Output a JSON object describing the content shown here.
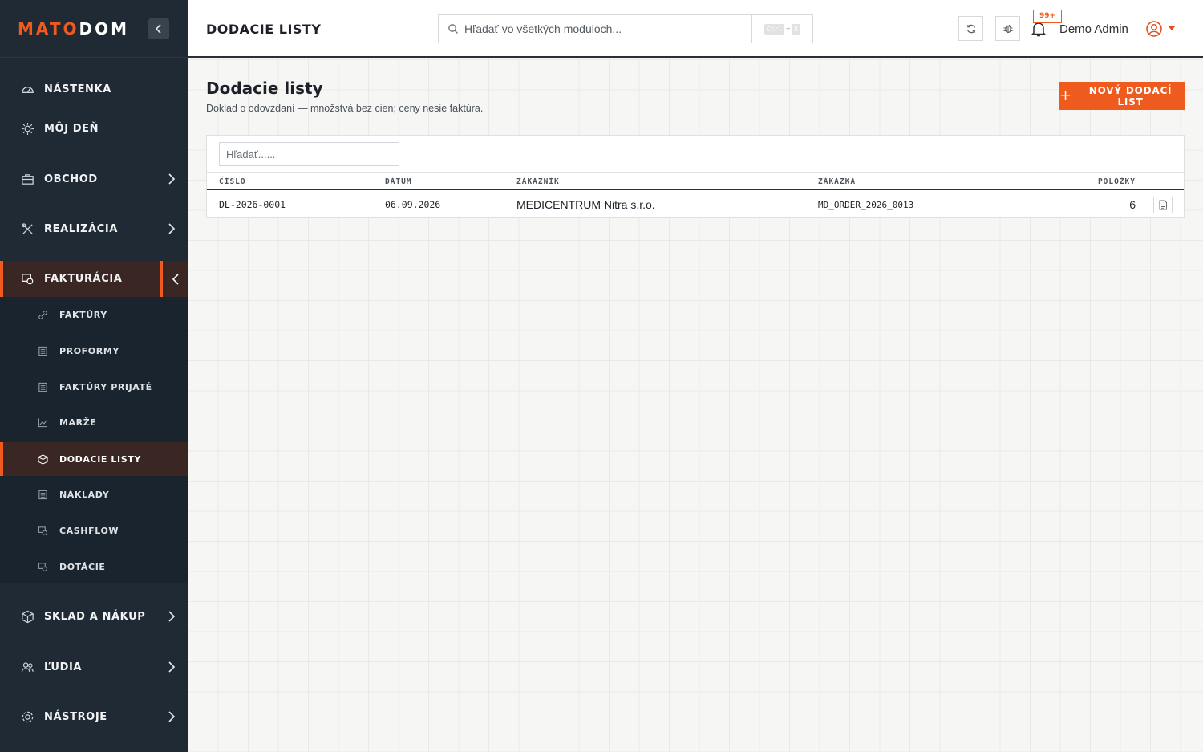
{
  "app": {
    "logo_left": "MATO",
    "logo_right": "DOM"
  },
  "sidebar": {
    "items": [
      {
        "label": "NÁSTENKA",
        "icon": "gauge-icon"
      },
      {
        "label": "MÔJ DEŇ",
        "icon": "sun-icon"
      },
      {
        "label": "OBCHOD",
        "icon": "briefcase-icon"
      },
      {
        "label": "REALIZÁCIA",
        "icon": "tools-icon"
      },
      {
        "label": "FAKTURÁCIA",
        "icon": "billing-icon"
      },
      {
        "label": "SKLAD A NÁKUP",
        "icon": "box-icon"
      },
      {
        "label": "ĽUDIA",
        "icon": "people-icon"
      },
      {
        "label": "NÁSTROJE",
        "icon": "gear-icon"
      }
    ],
    "submenu": [
      {
        "label": "FAKTÚRY",
        "icon": "link-icon"
      },
      {
        "label": "PROFORMY",
        "icon": "document-icon"
      },
      {
        "label": "FAKTÚRY PRIJATÉ",
        "icon": "document-icon"
      },
      {
        "label": "MARŽE",
        "icon": "chart-line-icon"
      },
      {
        "label": "DODACIE LISTY",
        "icon": "package-icon"
      },
      {
        "label": "NÁKLADY",
        "icon": "document-icon"
      },
      {
        "label": "CASHFLOW",
        "icon": "billing-icon"
      },
      {
        "label": "DOTÁCIE",
        "icon": "billing-icon"
      }
    ],
    "active_item": "FAKTURÁCIA",
    "active_subitem": "DODACIE LISTY"
  },
  "topbar": {
    "title": "DODACIE LISTY",
    "search_placeholder": "Hľadať vo všetkých moduloch...",
    "kbd_ctrl": "Ctrl",
    "kbd_plus": "+",
    "kbd_key": "K",
    "notification_badge": "99+",
    "user_name": "Demo Admin"
  },
  "page": {
    "heading": "Dodacie listy",
    "subtitle": "Doklad o odovzdaní — množstvá bez cien; ceny nesie faktúra.",
    "new_button_plus": "+",
    "new_button_label": "NOVÝ DODACÍ LIST",
    "filter_placeholder": "Hľadať......"
  },
  "table": {
    "columns": [
      "ČÍSLO",
      "DÁTUM",
      "ZÁKAZNÍK",
      "ZÁKAZKA",
      "POLOŽKY"
    ],
    "rows": [
      {
        "cislo": "DL-2026-0001",
        "datum": "06.09.2026",
        "zakaznik": "MEDICENTRUM Nitra s.r.o.",
        "zakazka": "MD_ORDER_2026_0013",
        "polozky": "6"
      }
    ]
  },
  "colors": {
    "accent": "#ef5a1f",
    "sidebar_bg": "#1f2a35",
    "active_bg": "#3a2724"
  }
}
